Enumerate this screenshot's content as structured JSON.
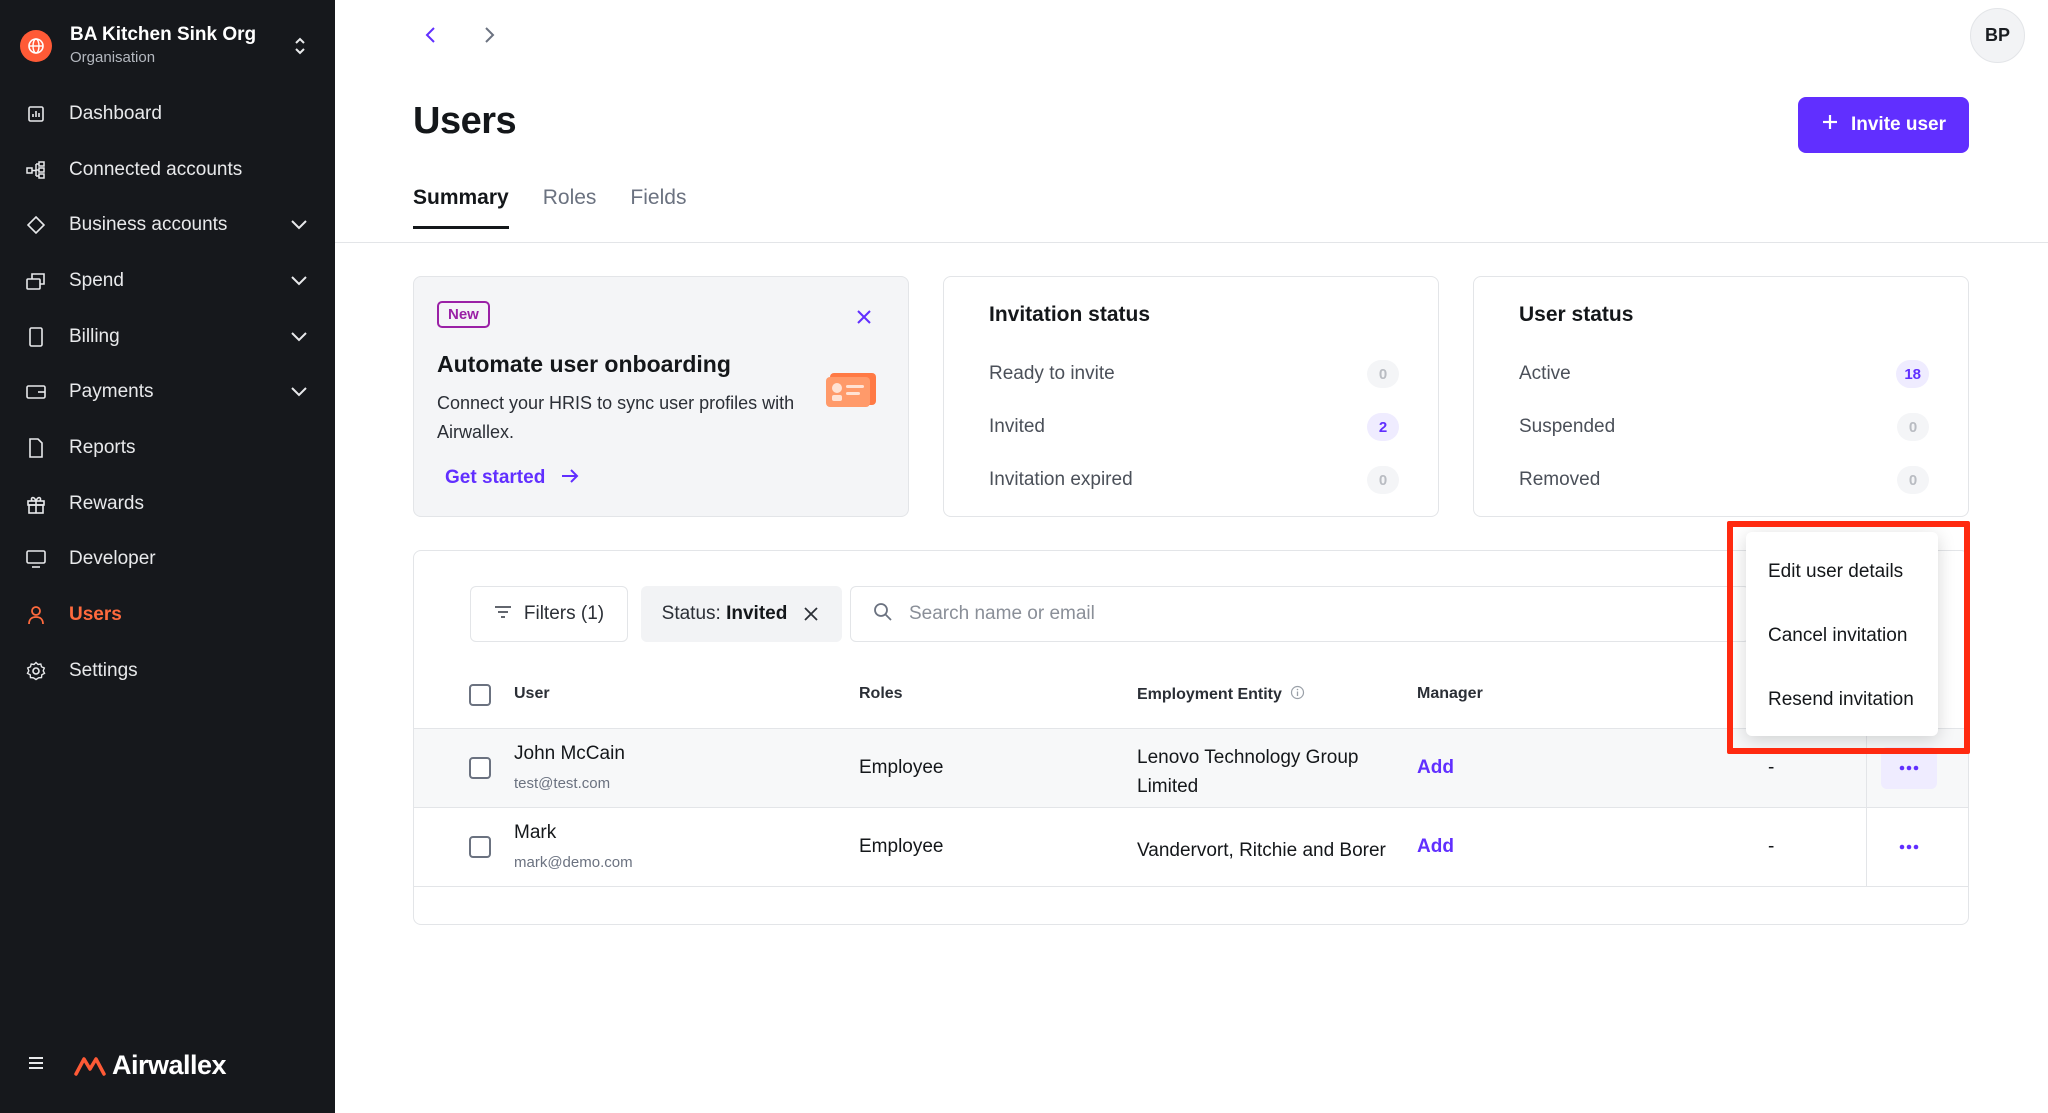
{
  "org": {
    "name": "BA Kitchen Sink Org",
    "subtitle": "Organisation"
  },
  "sidebar": {
    "items": [
      {
        "label": "Dashboard",
        "icon": "dashboard-icon",
        "expandable": false
      },
      {
        "label": "Connected accounts",
        "icon": "connected-accounts-icon",
        "expandable": false
      },
      {
        "label": "Business accounts",
        "icon": "diamond-icon",
        "expandable": true
      },
      {
        "label": "Spend",
        "icon": "spend-icon",
        "expandable": true
      },
      {
        "label": "Billing",
        "icon": "billing-icon",
        "expandable": true
      },
      {
        "label": "Payments",
        "icon": "payments-icon",
        "expandable": true
      },
      {
        "label": "Reports",
        "icon": "reports-icon",
        "expandable": false
      },
      {
        "label": "Rewards",
        "icon": "gift-icon",
        "expandable": false
      },
      {
        "label": "Developer",
        "icon": "monitor-icon",
        "expandable": false
      },
      {
        "label": "Users",
        "icon": "user-icon",
        "expandable": false,
        "active": true
      },
      {
        "label": "Settings",
        "icon": "gear-icon",
        "expandable": false
      }
    ],
    "brand": "Airwallex"
  },
  "header": {
    "avatar_initials": "BP",
    "title": "Users",
    "invite_label": "Invite user"
  },
  "tabs": [
    "Summary",
    "Roles",
    "Fields"
  ],
  "promo": {
    "badge": "New",
    "title": "Automate user onboarding",
    "body": "Connect your HRIS to sync user profiles with Airwallex.",
    "link": "Get started"
  },
  "invitation_status": {
    "title": "Invitation status",
    "rows": [
      {
        "label": "Ready to invite",
        "count": "0",
        "highlight": false
      },
      {
        "label": "Invited",
        "count": "2",
        "highlight": true
      },
      {
        "label": "Invitation expired",
        "count": "0",
        "highlight": false
      }
    ]
  },
  "user_status": {
    "title": "User status",
    "rows": [
      {
        "label": "Active",
        "count": "18",
        "highlight": true
      },
      {
        "label": "Suspended",
        "count": "0",
        "highlight": false
      },
      {
        "label": "Removed",
        "count": "0",
        "highlight": false
      }
    ]
  },
  "toolbar": {
    "filters_label": "Filters (1)",
    "status_prefix": "Status:",
    "status_value": "Invited",
    "search_placeholder": "Search name or email"
  },
  "table": {
    "columns": {
      "user": "User",
      "roles": "Roles",
      "entity": "Employment Entity",
      "manager": "Manager"
    },
    "rows": [
      {
        "name": "John McCain",
        "email": "test@test.com",
        "role": "Employee",
        "entity": "Lenovo Technology Group Limited",
        "manager": "Add",
        "extra": "-"
      },
      {
        "name": "Mark",
        "email": "mark@demo.com",
        "role": "Employee",
        "entity": "Vandervort, Ritchie and Borer",
        "manager": "Add",
        "extra": "-"
      }
    ]
  },
  "menu": {
    "items": [
      "Edit user details",
      "Cancel invitation",
      "Resend invitation"
    ]
  },
  "colors": {
    "accent": "#612fff",
    "brand_orange": "#ff5a36",
    "highlight_box": "#ff2a10",
    "sidebar_bg": "#16181c"
  }
}
